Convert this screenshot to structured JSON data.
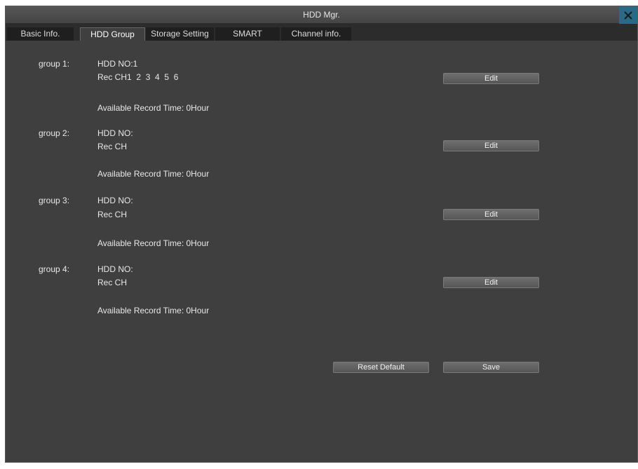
{
  "window": {
    "title": "HDD Mgr."
  },
  "tabs": [
    {
      "label": "Basic Info.",
      "active": false
    },
    {
      "label": "HDD Group",
      "active": true
    },
    {
      "label": "Storage Setting",
      "active": false
    },
    {
      "label": "SMART",
      "active": false
    },
    {
      "label": "Channel info.",
      "active": false
    }
  ],
  "groups": [
    {
      "label": "group 1:",
      "hdd_no": "HDD NO:1",
      "rec_ch": "Rec CH1  2  3  4  5  6",
      "available": "Available Record Time: 0Hour",
      "edit_label": "Edit"
    },
    {
      "label": "group 2:",
      "hdd_no": "HDD NO:",
      "rec_ch": "Rec CH",
      "available": "Available Record Time: 0Hour",
      "edit_label": "Edit"
    },
    {
      "label": "group 3:",
      "hdd_no": "HDD NO:",
      "rec_ch": "Rec CH",
      "available": "Available Record Time: 0Hour",
      "edit_label": "Edit"
    },
    {
      "label": "group 4:",
      "hdd_no": "HDD NO:",
      "rec_ch": "Rec CH",
      "available": "Available Record Time: 0Hour",
      "edit_label": "Edit"
    }
  ],
  "footer": {
    "reset_label": "Reset Default",
    "save_label": "Save"
  },
  "colors": {
    "window_bg": "#3f3f3f",
    "close_accent": "#2a6a86"
  },
  "icons": {
    "close": "close-icon"
  }
}
